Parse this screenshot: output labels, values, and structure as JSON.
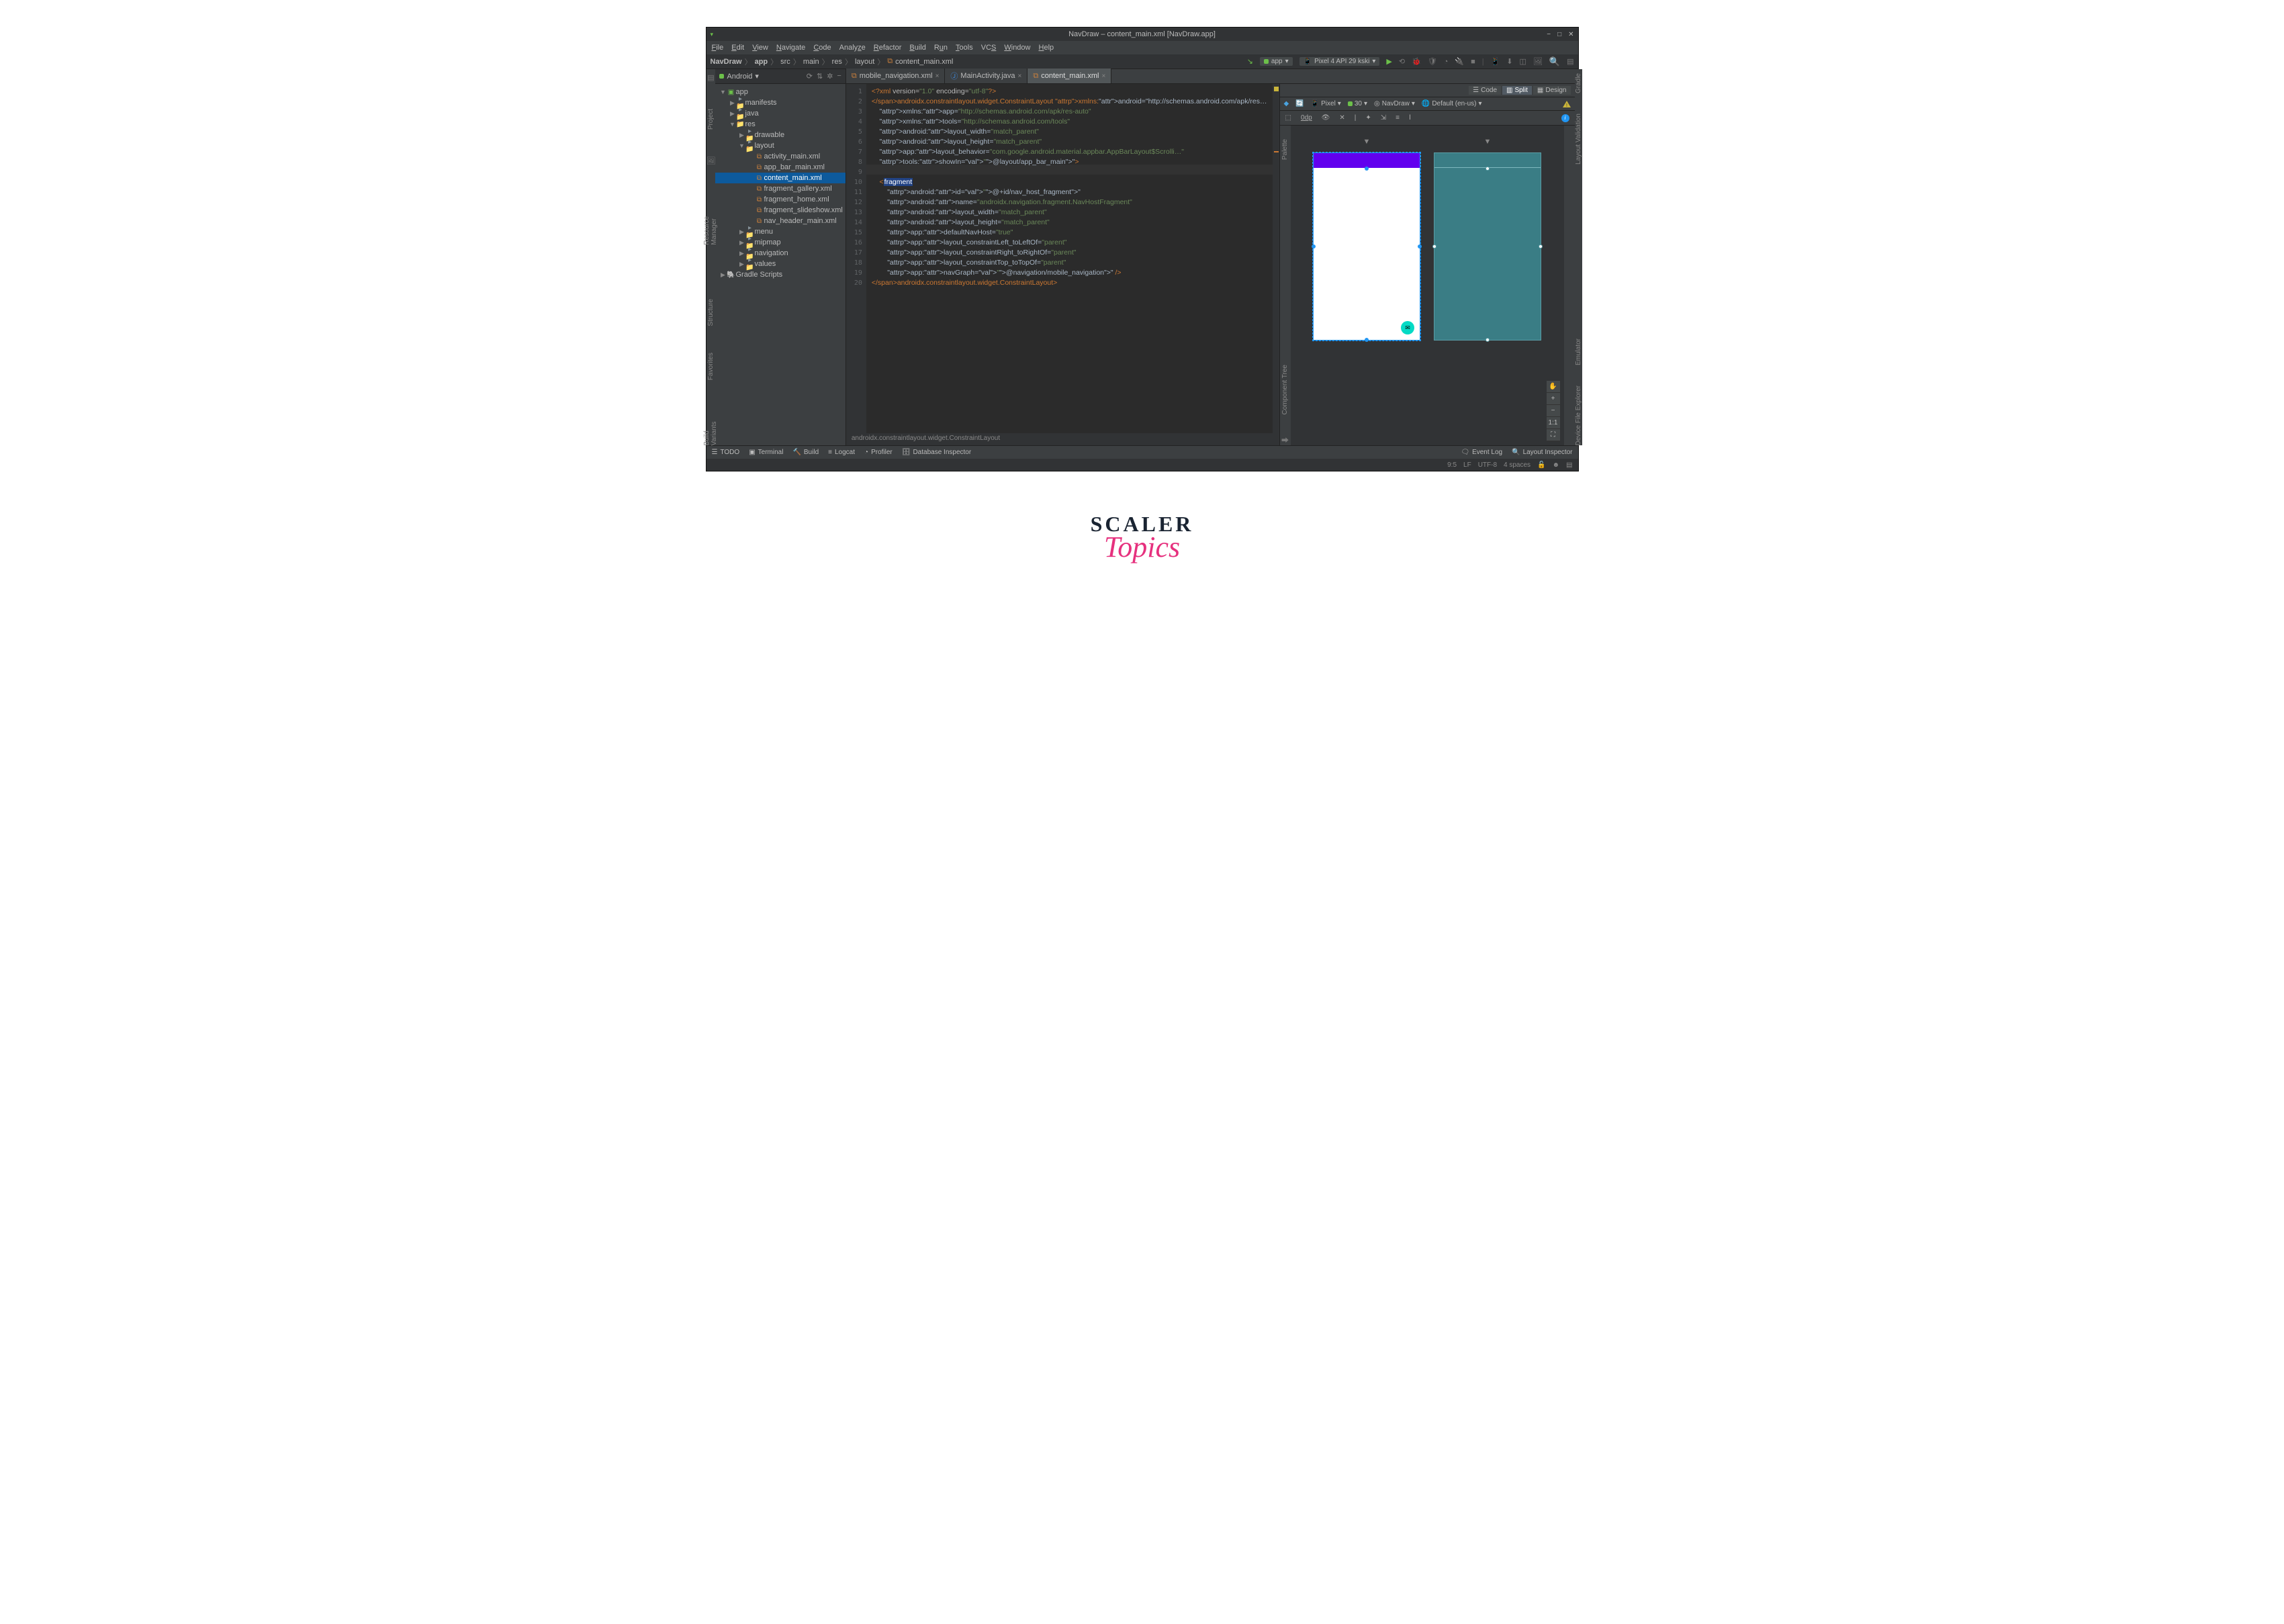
{
  "window": {
    "title": "NavDraw – content_main.xml [NavDraw.app]",
    "sys_icon_min": "−",
    "sys_icon_max": "□",
    "sys_icon_close": "✕"
  },
  "menu": [
    "File",
    "Edit",
    "View",
    "Navigate",
    "Code",
    "Analyze",
    "Refactor",
    "Build",
    "Run",
    "Tools",
    "VCS",
    "Window",
    "Help"
  ],
  "breadcrumbs": [
    "NavDraw",
    "app",
    "src",
    "main",
    "res",
    "layout",
    "content_main.xml"
  ],
  "toolbar": {
    "run_config_app": "app",
    "device": "Pixel 4 API 29 kski",
    "run": "▶"
  },
  "sidebar": {
    "selector": "Android",
    "tool_icons": [
      "⟳",
      "⇅",
      "✲",
      "−"
    ],
    "tree": [
      {
        "indent": 0,
        "arrow": "▼",
        "icon": "module",
        "name": "app"
      },
      {
        "indent": 1,
        "arrow": "▶",
        "icon": "folder",
        "name": "manifests"
      },
      {
        "indent": 1,
        "arrow": "▶",
        "icon": "folder",
        "name": "java"
      },
      {
        "indent": 1,
        "arrow": "▼",
        "icon": "folder-res",
        "name": "res"
      },
      {
        "indent": 2,
        "arrow": "▶",
        "icon": "folder",
        "name": "drawable"
      },
      {
        "indent": 2,
        "arrow": "▼",
        "icon": "folder",
        "name": "layout"
      },
      {
        "indent": 3,
        "arrow": "",
        "icon": "xml",
        "name": "activity_main.xml"
      },
      {
        "indent": 3,
        "arrow": "",
        "icon": "xml",
        "name": "app_bar_main.xml"
      },
      {
        "indent": 3,
        "arrow": "",
        "icon": "xml",
        "name": "content_main.xml",
        "selected": true
      },
      {
        "indent": 3,
        "arrow": "",
        "icon": "xml",
        "name": "fragment_gallery.xml"
      },
      {
        "indent": 3,
        "arrow": "",
        "icon": "xml",
        "name": "fragment_home.xml"
      },
      {
        "indent": 3,
        "arrow": "",
        "icon": "xml",
        "name": "fragment_slideshow.xml"
      },
      {
        "indent": 3,
        "arrow": "",
        "icon": "xml",
        "name": "nav_header_main.xml"
      },
      {
        "indent": 2,
        "arrow": "▶",
        "icon": "folder",
        "name": "menu"
      },
      {
        "indent": 2,
        "arrow": "▶",
        "icon": "folder",
        "name": "mipmap"
      },
      {
        "indent": 2,
        "arrow": "▶",
        "icon": "folder",
        "name": "navigation"
      },
      {
        "indent": 2,
        "arrow": "▶",
        "icon": "folder",
        "name": "values"
      },
      {
        "indent": 0,
        "arrow": "▶",
        "icon": "gradle",
        "name": "Gradle Scripts"
      }
    ]
  },
  "left_gutter": [
    "Project",
    "Resource Manager",
    "Structure",
    "Favorites",
    "Build Variants"
  ],
  "right_gutter": [
    "Gradle",
    "Layout Validation",
    "Emulator",
    "Device File Explorer"
  ],
  "editor": {
    "tabs": [
      {
        "icon": "xml",
        "label": "mobile_navigation.xml"
      },
      {
        "icon": "java",
        "label": "MainActivity.java"
      },
      {
        "icon": "xml",
        "label": "content_main.xml",
        "active": true
      }
    ],
    "crumb": "androidx.constraintlayout.widget.ConstraintLayout",
    "lines": [
      "<?xml version=\"1.0\" encoding=\"utf-8\"?>",
      "<androidx.constraintlayout.widget.ConstraintLayout xmlns:android=\"http://schemas.android.com/apk/res…",
      "    xmlns:app=\"http://schemas.android.com/apk/res-auto\"",
      "    xmlns:tools=\"http://schemas.android.com/tools\"",
      "    android:layout_width=\"match_parent\"",
      "    android:layout_height=\"match_parent\"",
      "    app:layout_behavior=\"com.google.android.material.appbar.AppBarLayout$Scrolli…\"",
      "    tools:showIn=\"@layout/app_bar_main\">",
      "",
      "    <fragment",
      "        android:id=\"@+id/nav_host_fragment\"",
      "        android:name=\"androidx.navigation.fragment.NavHostFragment\"",
      "        android:layout_width=\"match_parent\"",
      "        android:layout_height=\"match_parent\"",
      "        app:defaultNavHost=\"true\"",
      "        app:layout_constraintLeft_toLeftOf=\"parent\"",
      "        app:layout_constraintRight_toRightOf=\"parent\"",
      "        app:layout_constraintTop_toTopOf=\"parent\"",
      "        app:navGraph=\"@navigation/mobile_navigation\" />",
      "</androidx.constraintlayout.widget.ConstraintLayout>"
    ]
  },
  "design": {
    "view_tabs": {
      "code": "Code",
      "split": "Split",
      "design": "Design"
    },
    "toolbar": {
      "device": "Pixel",
      "api": "30",
      "theme": "NavDraw",
      "locale": "Default (en-us)"
    },
    "toolbar2": {
      "zoom_label": "0dp"
    },
    "left_strip": [
      "Palette",
      "Component Tree"
    ],
    "zoom": {
      "plus": "+",
      "minus": "−",
      "fit": "1:1",
      "expand": "⛶"
    }
  },
  "bottom": {
    "items": [
      "TODO",
      "Terminal",
      "Build",
      "Logcat",
      "Profiler",
      "Database Inspector"
    ],
    "event_log": "Event Log",
    "layout_inspector": "Layout Inspector"
  },
  "status": {
    "pos": "9:5",
    "le": "LF",
    "enc": "UTF-8",
    "indent": "4 spaces"
  },
  "branding": {
    "line1": "SCALER",
    "line2": "Topics"
  }
}
